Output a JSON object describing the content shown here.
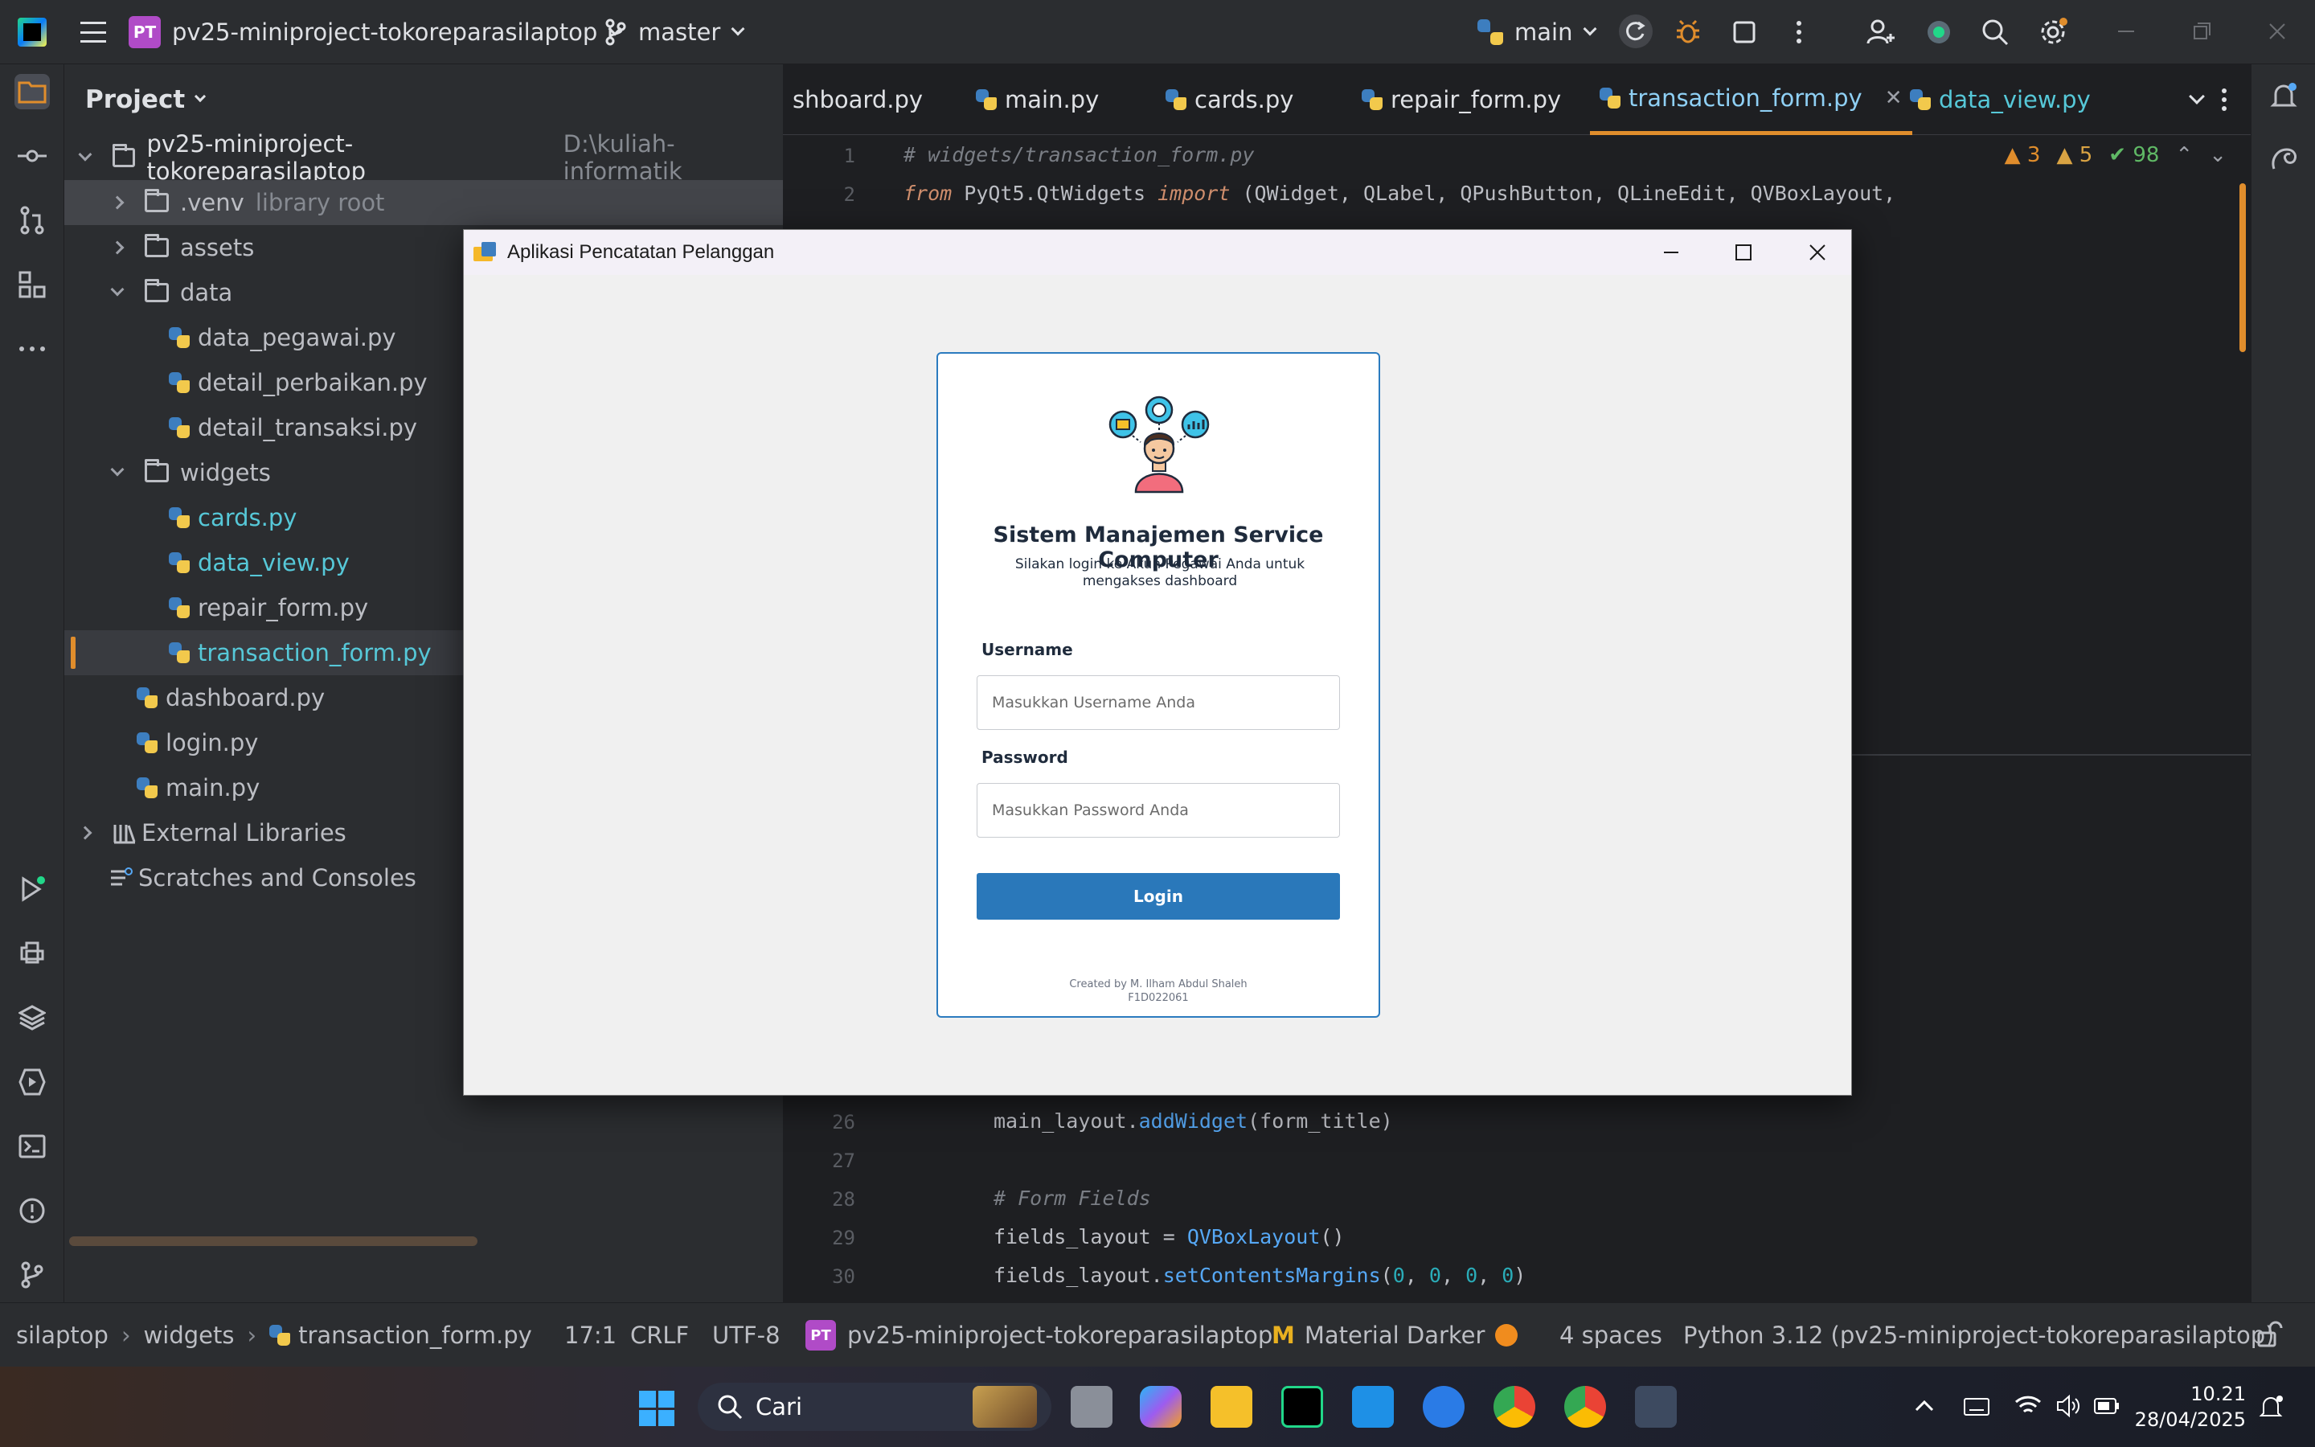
{
  "titlebar": {
    "project_badge": "PT",
    "project_name": "pv25-miniproject-tokoreparasilaptop",
    "branch": "master",
    "run_config": "main"
  },
  "project_panel": {
    "header": "Project",
    "tree": [
      {
        "label": "pv25-miniproject-tokoreparasilaptop",
        "hint": "D:\\kuliah-informatik",
        "kind": "root"
      },
      {
        "label": ".venv",
        "hint": "library root",
        "kind": "folder"
      },
      {
        "label": "assets",
        "kind": "folder"
      },
      {
        "label": "data",
        "kind": "folder"
      },
      {
        "label": "data_pegawai.py",
        "kind": "file"
      },
      {
        "label": "detail_perbaikan.py",
        "kind": "file"
      },
      {
        "label": "detail_transaksi.py",
        "kind": "file"
      },
      {
        "label": "widgets",
        "kind": "folder"
      },
      {
        "label": "cards.py",
        "kind": "file"
      },
      {
        "label": "data_view.py",
        "kind": "file"
      },
      {
        "label": "repair_form.py",
        "kind": "file"
      },
      {
        "label": "transaction_form.py",
        "kind": "file"
      },
      {
        "label": "dashboard.py",
        "kind": "file"
      },
      {
        "label": "login.py",
        "kind": "file"
      },
      {
        "label": "main.py",
        "kind": "file"
      },
      {
        "label": "External Libraries",
        "kind": "lib"
      },
      {
        "label": "Scratches and Consoles",
        "kind": "scratch"
      }
    ]
  },
  "tabs": [
    {
      "label": "shboard.py"
    },
    {
      "label": "main.py"
    },
    {
      "label": "cards.py"
    },
    {
      "label": "repair_form.py"
    },
    {
      "label": "transaction_form.py"
    },
    {
      "label": "data_view.py"
    }
  ],
  "inspections": {
    "errors": "3",
    "warnings": "5",
    "ok": "98"
  },
  "code": {
    "l1_num": "1",
    "l1": "# widgets/transaction_form.py",
    "l2_num": "2",
    "l2_kw1": "from",
    "l2_a": " PyQt5.QtWidgets ",
    "l2_kw2": "import",
    "l2_b": " (QWidget, QLabel, QPushButton, QLineEdit, QVBoxLayout,",
    "l26_num": "26",
    "l26_a": "main_layout.",
    "l26_fn": "addWidget",
    "l26_b": "(form_title)",
    "l27_num": "27",
    "l28_num": "28",
    "l28": "# Form Fields",
    "l29_num": "29",
    "l29_a": "fields_layout = ",
    "l29_fn": "QVBoxLayout",
    "l29_b": "()",
    "l30_num": "30",
    "l30_a": "fields_layout.",
    "l30_fn": "setContentsMargins",
    "l30_b": "(",
    "l30_n1": "0",
    "l30_c1": ", ",
    "l30_n2": "0",
    "l30_c2": ", ",
    "l30_n3": "0",
    "l30_c3": ", ",
    "l30_n4": "0",
    "l30_e": ")"
  },
  "statusbar": {
    "crumb1": "silaptop",
    "crumb2": "widgets",
    "crumb3": "transaction_form.py",
    "position": "17:1",
    "line_sep": "CRLF",
    "encoding": "UTF-8",
    "project_badge": "PT",
    "project": "pv25-miniproject-tokoreparasilaptop",
    "theme": "Material Darker",
    "indent": "4 spaces",
    "interpreter": "Python 3.12 (pv25-miniproject-tokoreparasilaptop)"
  },
  "taskbar": {
    "search_label": "Cari",
    "time": "10.21",
    "date": "28/04/2025"
  },
  "app_window": {
    "title": "Aplikasi Pencatatan Pelanggan",
    "heading": "Sistem Manajemen Service Computer",
    "subtitle": "Silakan login ke Akun Pegawai Anda untuk mengakses dashboard",
    "username_label": "Username",
    "username_placeholder": "Masukkan Username Anda",
    "password_label": "Password",
    "password_placeholder": "Masukkan Password Anda",
    "login_button": "Login",
    "footer_line1": "Created by M. Ilham Abdul Shaleh",
    "footer_line2": "F1D022061"
  },
  "colors": {
    "accent_orange": "#e08d2c",
    "login_button": "#2a78ba",
    "card_border": "#2b7bbf",
    "ide_background": "#1e1f22"
  }
}
